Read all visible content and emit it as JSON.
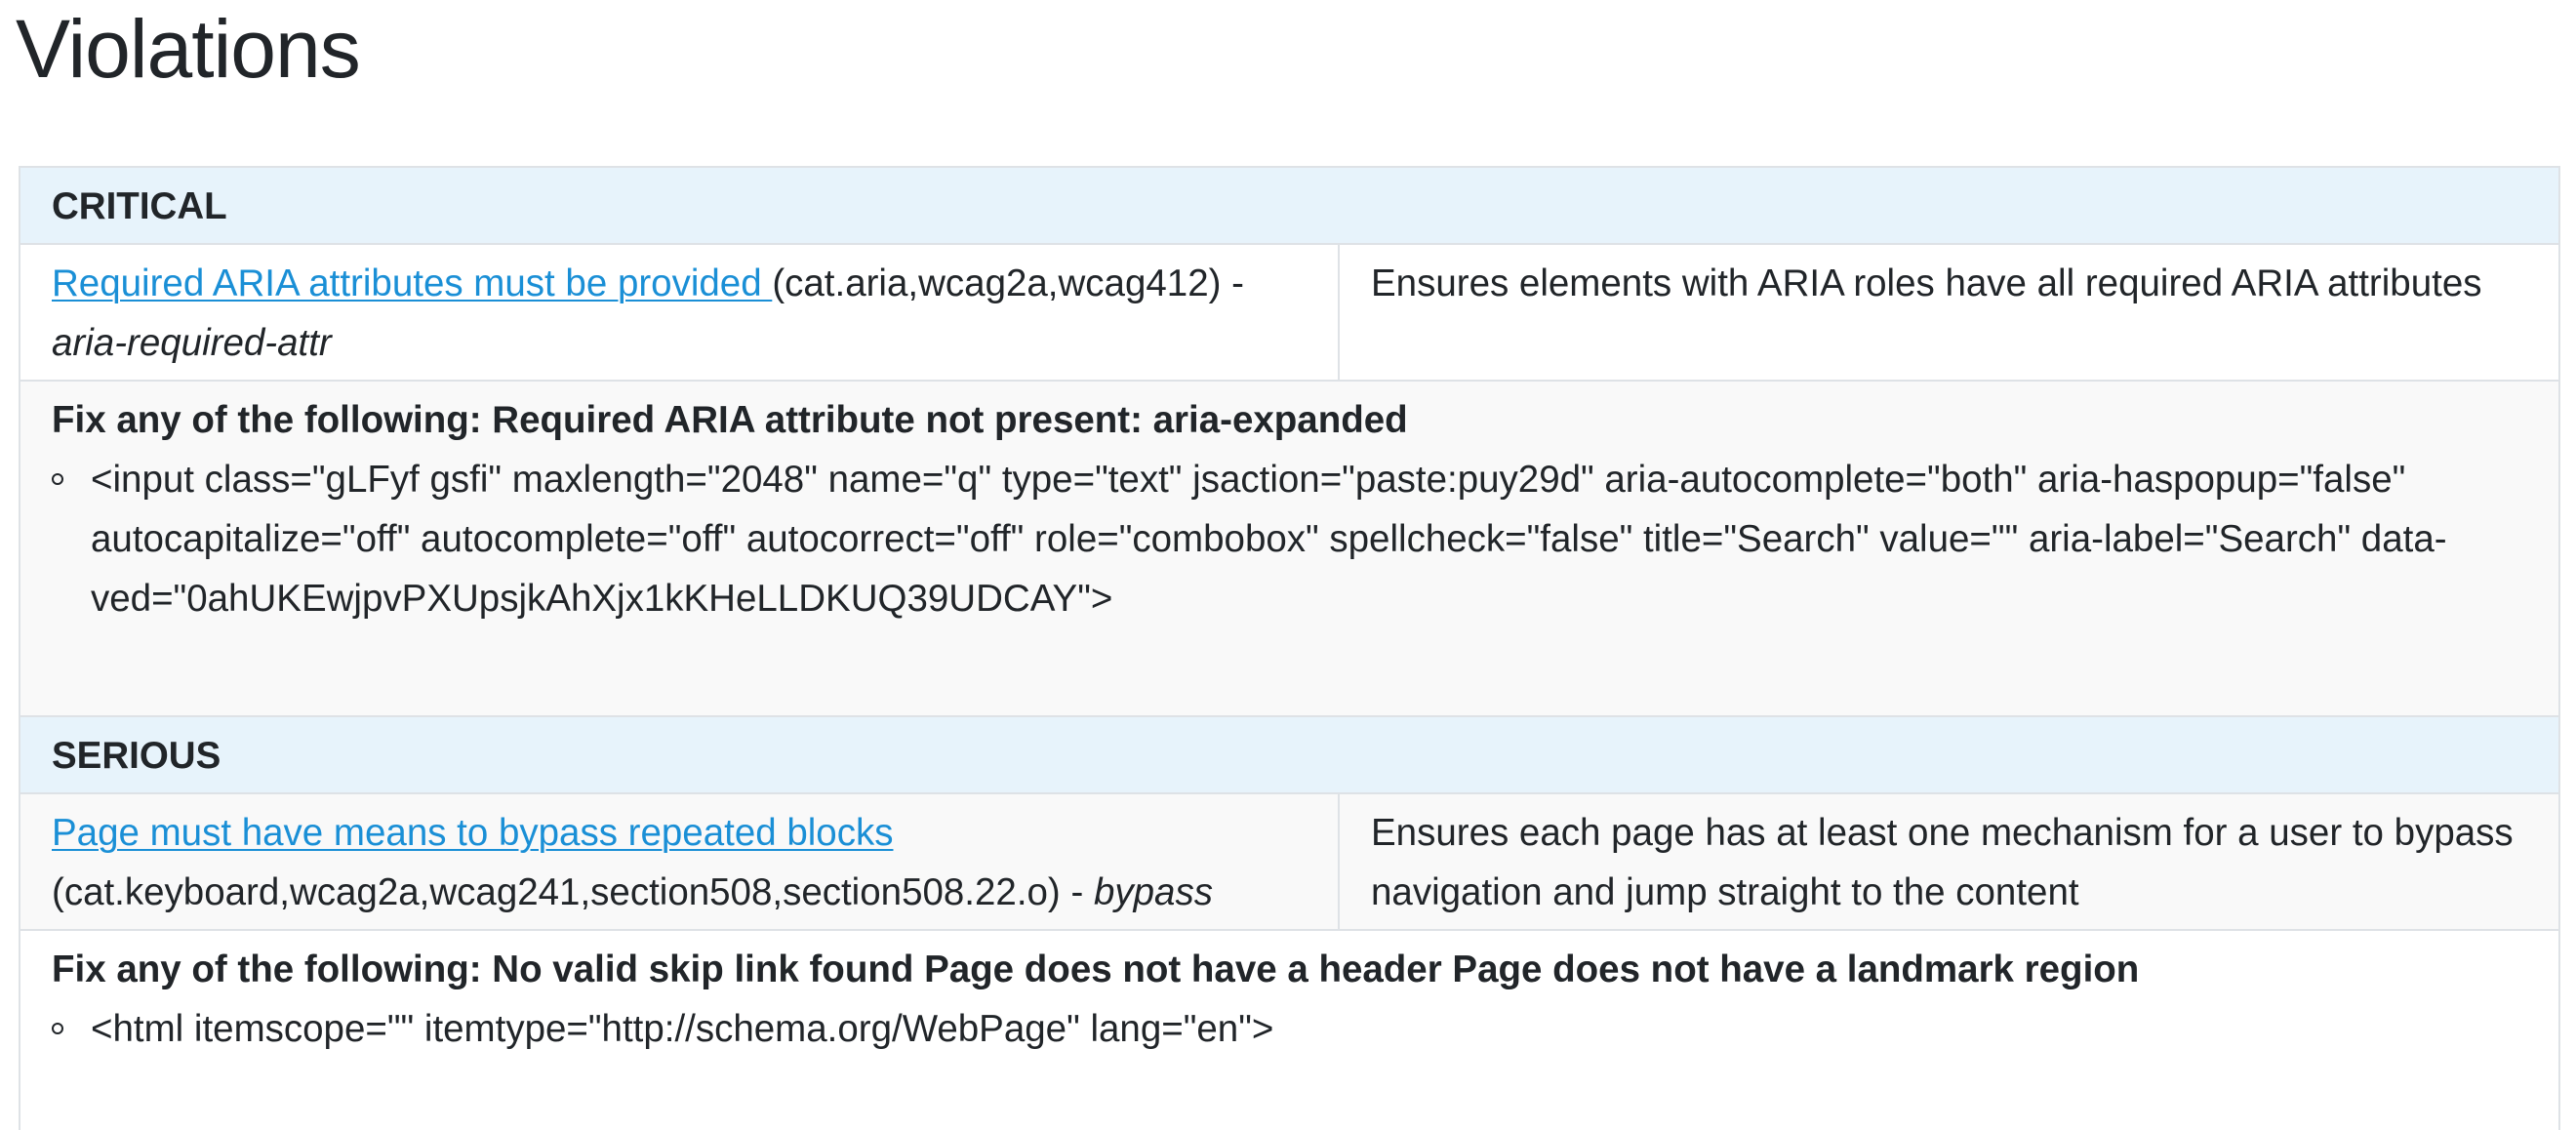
{
  "page": {
    "title": "Violations"
  },
  "violations": [
    {
      "impact": "CRITICAL",
      "rule_name": "Required ARIA attributes must be provided ",
      "tags": "(cat.aria,wcag2a,wcag412) - ",
      "rule_id": "aria-required-attr",
      "description": "Ensures elements with ARIA roles have all required ARIA attributes",
      "fix_summary": "Fix any of the following: Required ARIA attribute not present: aria-expanded",
      "nodes": [
        "<input class=\"gLFyf gsfi\" maxlength=\"2048\" name=\"q\" type=\"text\" jsaction=\"paste:puy29d\" aria-autocomplete=\"both\" aria-haspopup=\"false\" autocapitalize=\"off\" autocomplete=\"off\" autocorrect=\"off\" role=\"combobox\" spellcheck=\"false\" title=\"Search\" value=\"\" aria-label=\"Search\" data-ved=\"0ahUKEwjpvPXUpsjkAhXjx1kKHeLLDKUQ39UDCAY\">"
      ]
    },
    {
      "impact": "SERIOUS",
      "rule_name": "Page must have means to bypass repeated blocks",
      "tags": "(cat.keyboard,wcag2a,wcag241,section508,section508.22.o) - ",
      "rule_id": "bypass",
      "description": "Ensures each page has at least one mechanism for a user to bypass navigation and jump straight to the content",
      "fix_summary": "Fix any of the following: No valid skip link found Page does not have a header Page does not have a landmark region",
      "nodes": [
        "<html itemscope=\"\" itemtype=\"http://schema.org/WebPage\" lang=\"en\">"
      ]
    }
  ],
  "colors": {
    "link": "#1a8fd6",
    "impact_header_bg": "#e7f3fb",
    "row_shade_bg": "#f9f9f9",
    "border": "#dee2e6",
    "text": "#212529"
  }
}
